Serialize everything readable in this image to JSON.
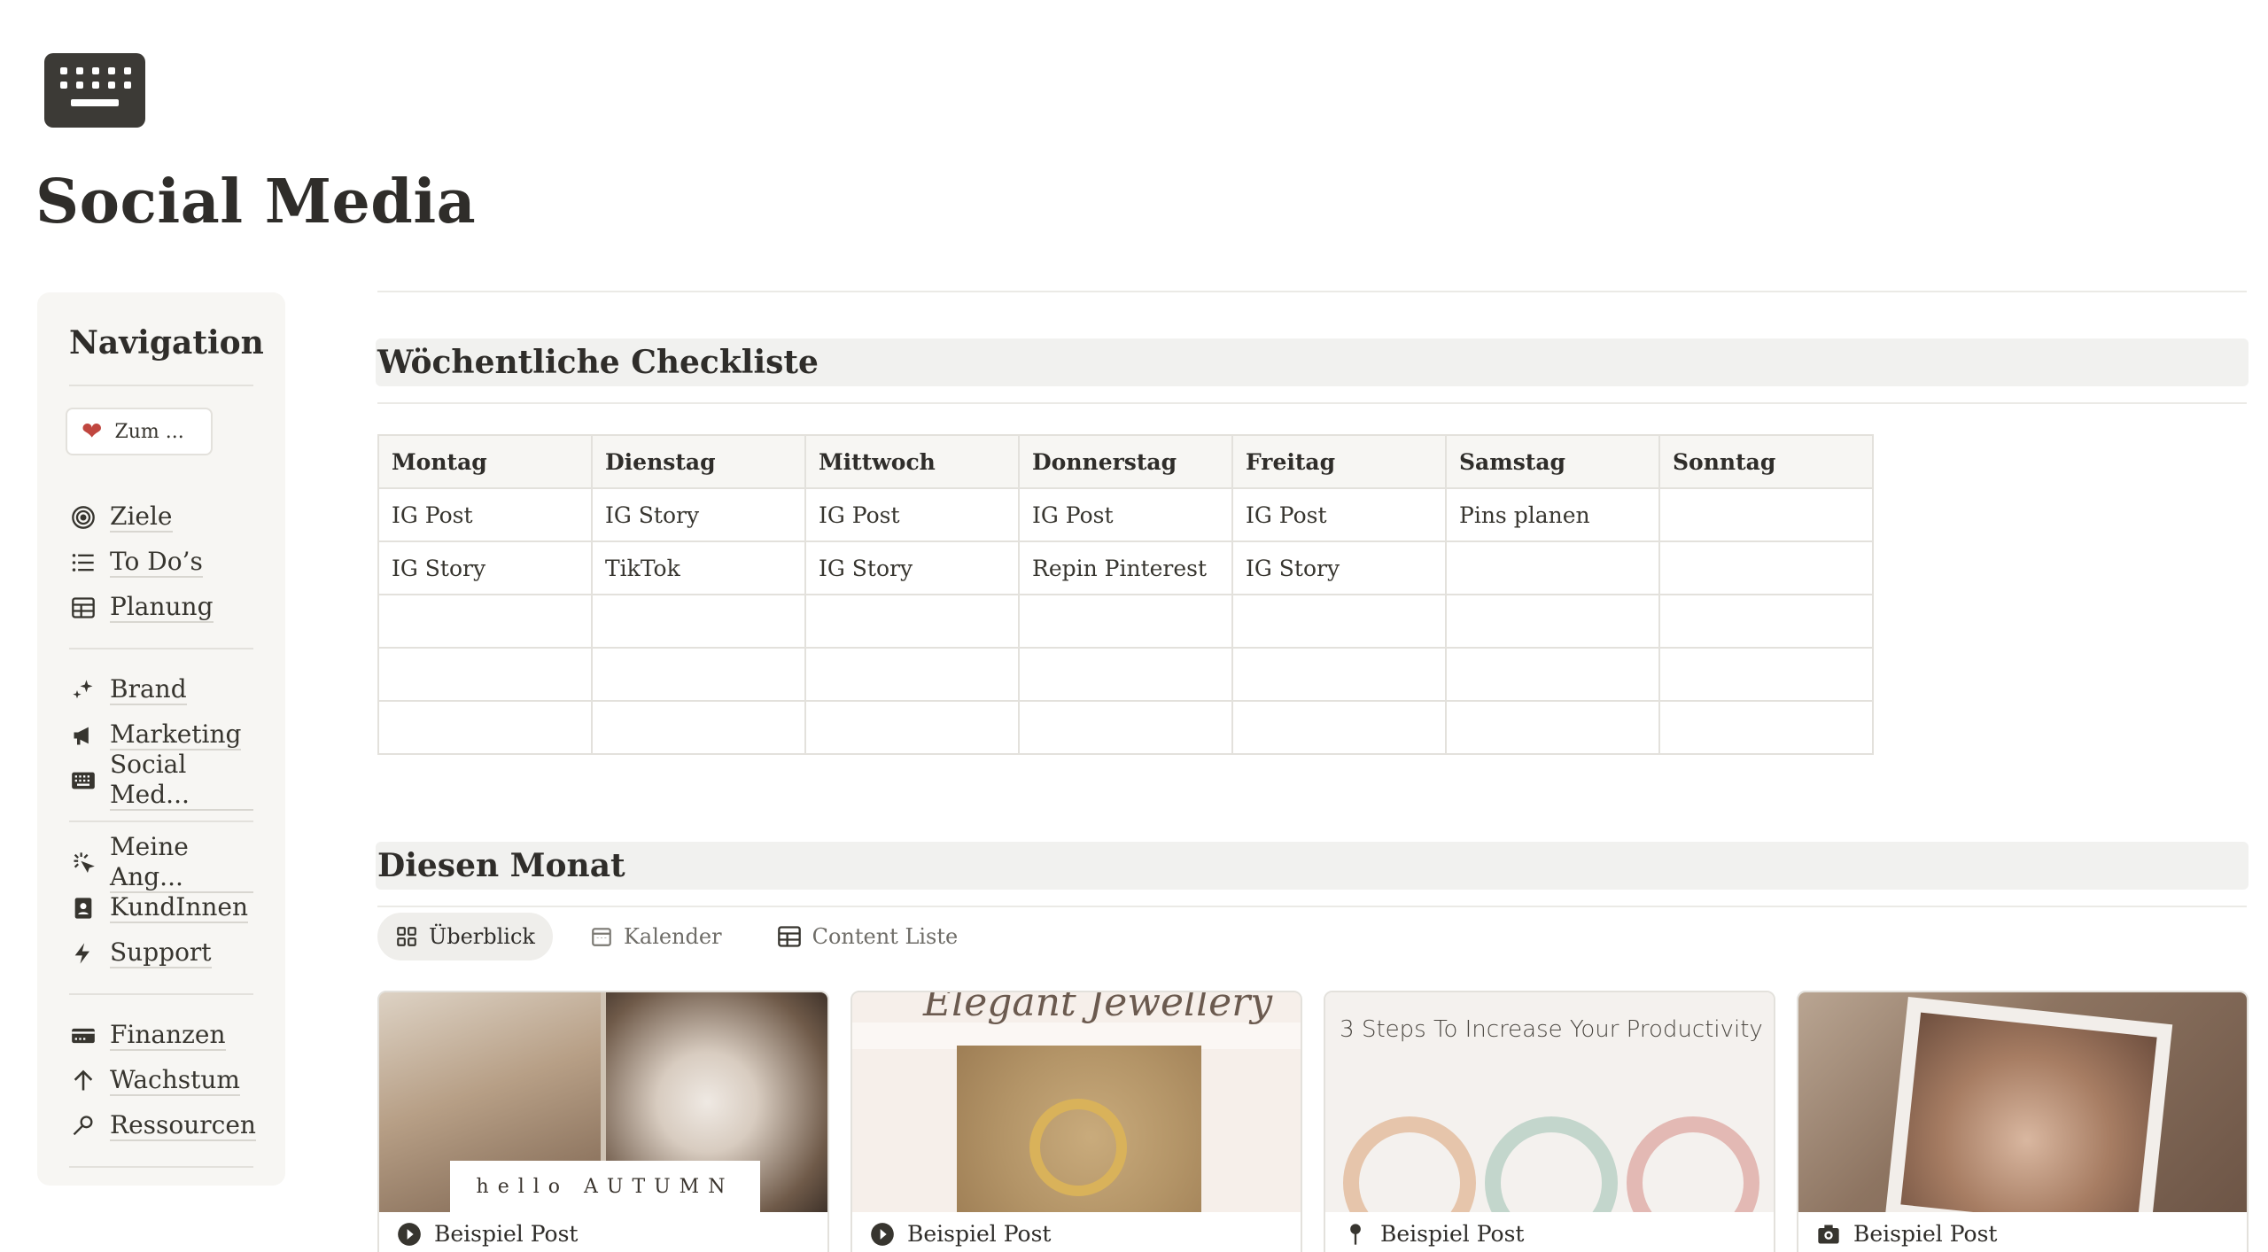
{
  "page": {
    "icon": "keyboard-icon",
    "title": "Social Media"
  },
  "navigation": {
    "title": "Navigation",
    "back_button": {
      "icon": "heart-icon",
      "label": "Zum ..."
    },
    "groups": [
      [
        {
          "icon": "target-icon",
          "label": "Ziele"
        },
        {
          "icon": "list-icon",
          "label": "To Do’s"
        },
        {
          "icon": "table-icon",
          "label": "Planung"
        }
      ],
      [
        {
          "icon": "sparkles-icon",
          "label": "Brand"
        },
        {
          "icon": "megaphone-icon",
          "label": "Marketing"
        },
        {
          "icon": "keyboard-icon",
          "label": "Social Med..."
        }
      ],
      [
        {
          "icon": "cursor-click-icon",
          "label": "Meine Ang..."
        },
        {
          "icon": "contact-book-icon",
          "label": "KundInnen"
        },
        {
          "icon": "lightning-icon",
          "label": "Support"
        }
      ],
      [
        {
          "icon": "credit-card-icon",
          "label": "Finanzen"
        },
        {
          "icon": "arrow-up-icon",
          "label": "Wachstum"
        },
        {
          "icon": "wrench-icon",
          "label": "Ressourcen"
        }
      ]
    ]
  },
  "weekly": {
    "heading": "Wöchentliche Checkliste",
    "columns": [
      "Montag",
      "Dienstag",
      "Mittwoch",
      "Donnerstag",
      "Freitag",
      "Samstag",
      "Sonntag"
    ],
    "rows": [
      [
        "IG Post",
        "IG Story",
        "IG Post",
        "IG Post",
        "IG Post",
        "Pins planen",
        ""
      ],
      [
        "IG Story",
        "TikTok",
        "IG Story",
        "Repin Pinterest",
        "IG Story",
        "",
        ""
      ],
      [
        "",
        "",
        "",
        "",
        "",
        "",
        ""
      ],
      [
        "",
        "",
        "",
        "",
        "",
        "",
        ""
      ],
      [
        "",
        "",
        "",
        "",
        "",
        "",
        ""
      ]
    ]
  },
  "month": {
    "heading": "Diesen Monat",
    "tabs": [
      {
        "icon": "gallery-icon",
        "label": "Überblick",
        "active": true
      },
      {
        "icon": "calendar-icon",
        "label": "Kalender",
        "active": false
      },
      {
        "icon": "table-icon",
        "label": "Content Liste",
        "active": false
      }
    ],
    "cards": [
      {
        "icon": "play-icon",
        "label": "Beispiel Post",
        "thumb_text": "hello AUTUMN"
      },
      {
        "icon": "play-icon",
        "label": "Beispiel Post",
        "thumb_text": "Elegant Jewellery"
      },
      {
        "icon": "pin-icon",
        "label": "Beispiel Post",
        "thumb_text": "3 Steps To Increase Your Productivity"
      },
      {
        "icon": "camera-icon",
        "label": "Beispiel Post",
        "thumb_text": ""
      }
    ]
  },
  "colors": {
    "text": "#37352f",
    "nav_bg": "#f7f6f3",
    "heading_bg": "#f1f1ef",
    "border": "#e3e1dc",
    "heart": "#c0463f"
  }
}
